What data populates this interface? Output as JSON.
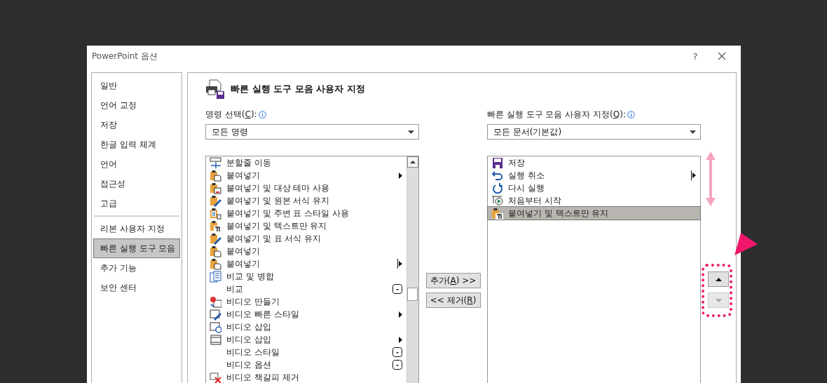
{
  "window": {
    "title": "PowerPoint 옵션",
    "help": "?"
  },
  "sidebar": {
    "items": [
      {
        "label": "일반",
        "selected": false,
        "divider_before": false
      },
      {
        "label": "언어 교정",
        "selected": false,
        "divider_before": false
      },
      {
        "label": "저장",
        "selected": false,
        "divider_before": false
      },
      {
        "label": "한글 입력 체계",
        "selected": false,
        "divider_before": false
      },
      {
        "label": "언어",
        "selected": false,
        "divider_before": false
      },
      {
        "label": "접근성",
        "selected": false,
        "divider_before": false
      },
      {
        "label": "고급",
        "selected": false,
        "divider_before": false
      },
      {
        "label": "리본 사용자 지정",
        "selected": false,
        "divider_before": true
      },
      {
        "label": "빠른 실행 도구 모음",
        "selected": true,
        "divider_before": false
      },
      {
        "label": "추가 기능",
        "selected": false,
        "divider_before": false
      },
      {
        "label": "보안 센터",
        "selected": false,
        "divider_before": false
      }
    ]
  },
  "page_title": "빠른 실행 도구 모음 사용자 지정",
  "commands": {
    "label": {
      "before": "명령 선택(",
      "key": "C",
      "after": "):"
    },
    "dropdown": "모든 명령",
    "items": [
      {
        "label": "분할줄 이동",
        "kind": "split",
        "submenu": false,
        "split": false,
        "gallery": false,
        "selected": false
      },
      {
        "label": "붙여넣기",
        "kind": "paste",
        "submenu": true,
        "split": false,
        "gallery": false,
        "selected": false
      },
      {
        "label": "붙여넣기 및 대상 테마 사용",
        "kind": "pastetheme",
        "submenu": false,
        "split": false,
        "gallery": false,
        "selected": false
      },
      {
        "label": "붙여넣기 및 원본 서식 유지",
        "kind": "pastebrush",
        "submenu": false,
        "split": false,
        "gallery": false,
        "selected": false
      },
      {
        "label": "붙여넣기 및 주변 표 스타일 사용",
        "kind": "pastedoc",
        "submenu": false,
        "split": false,
        "gallery": false,
        "selected": false
      },
      {
        "label": "붙여넣기 및 텍스트만 유지",
        "kind": "pastetext",
        "submenu": false,
        "split": false,
        "gallery": false,
        "selected": false
      },
      {
        "label": "붙여넣기 및 표 서식 유지",
        "kind": "pastebrush",
        "submenu": false,
        "split": false,
        "gallery": false,
        "selected": false
      },
      {
        "label": "붙여넣기",
        "kind": "paste",
        "submenu": false,
        "split": false,
        "gallery": false,
        "selected": false
      },
      {
        "label": "붙여넣기",
        "kind": "paste",
        "submenu": false,
        "split": true,
        "gallery": false,
        "selected": false
      },
      {
        "label": "비교 및 병합",
        "kind": "compare",
        "submenu": false,
        "split": false,
        "gallery": false,
        "selected": false
      },
      {
        "label": "비교",
        "kind": "plain",
        "submenu": false,
        "split": false,
        "gallery": true,
        "selected": false
      },
      {
        "label": "비디오 만들기",
        "kind": "videomake",
        "submenu": false,
        "split": false,
        "gallery": false,
        "selected": false
      },
      {
        "label": "비디오 빠른 스타일",
        "kind": "videostyle",
        "submenu": true,
        "split": false,
        "gallery": false,
        "selected": false
      },
      {
        "label": "비디오 삽입",
        "kind": "videoweb",
        "submenu": false,
        "split": false,
        "gallery": false,
        "selected": false
      },
      {
        "label": "비디오 삽입",
        "kind": "film",
        "submenu": true,
        "split": false,
        "gallery": false,
        "selected": false
      },
      {
        "label": "비디오 스타일",
        "kind": "plain",
        "submenu": false,
        "split": false,
        "gallery": true,
        "selected": false
      },
      {
        "label": "비디오 옵션",
        "kind": "plain",
        "submenu": false,
        "split": false,
        "gallery": true,
        "selected": false
      },
      {
        "label": "비디오 책갈피 제거",
        "kind": "videoremove",
        "submenu": false,
        "split": false,
        "gallery": false,
        "selected": false
      }
    ]
  },
  "toolbar": {
    "label": {
      "before": "빠른 실행 도구 모음 사용자 지정(",
      "key": "Q",
      "after": "):"
    },
    "dropdown": "모든 문서(기본값)",
    "items": [
      {
        "label": "저장",
        "kind": "save",
        "submenu": false,
        "split": false,
        "gallery": false,
        "selected": false
      },
      {
        "label": "실행 취소",
        "kind": "undo",
        "submenu": false,
        "split": true,
        "gallery": false,
        "selected": false
      },
      {
        "label": "다시 실행",
        "kind": "redo",
        "submenu": false,
        "split": false,
        "gallery": false,
        "selected": false
      },
      {
        "label": "처음부터 시작",
        "kind": "slideshow",
        "submenu": false,
        "split": false,
        "gallery": false,
        "selected": false
      },
      {
        "label": "붙여넣기 및 텍스트만 유지",
        "kind": "pastetext",
        "submenu": false,
        "split": false,
        "gallery": false,
        "selected": true
      }
    ]
  },
  "add_button": {
    "before": "추가(",
    "key": "A",
    "after": ") >>"
  },
  "remove_button": {
    "before": "<< 제거(",
    "key": "R",
    "after": ")"
  },
  "move_up": {
    "disabled": false
  },
  "move_down": {
    "disabled": true
  }
}
